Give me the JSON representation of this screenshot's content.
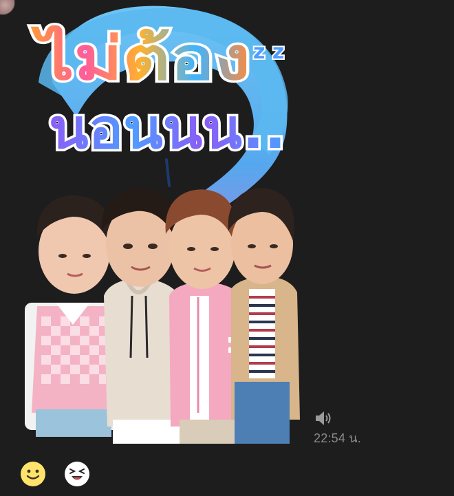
{
  "message": {
    "sticker": {
      "caption_line1": "ไม่ต้อง",
      "caption_line2": "นอนนน..",
      "zz_text": "z z"
    },
    "timestamp": "22:54 น.",
    "icons": {
      "sender_avatar": "avatar",
      "speaker": "speaker-icon"
    }
  },
  "input_bar": {
    "icons": {
      "emoji": "smiley-face-icon",
      "sticker": "grinning-sticker-icon"
    }
  },
  "colors": {
    "background": "#1d1d1d",
    "timestamp": "#8b8b8b",
    "sticker_blob": "#56b7ee"
  }
}
